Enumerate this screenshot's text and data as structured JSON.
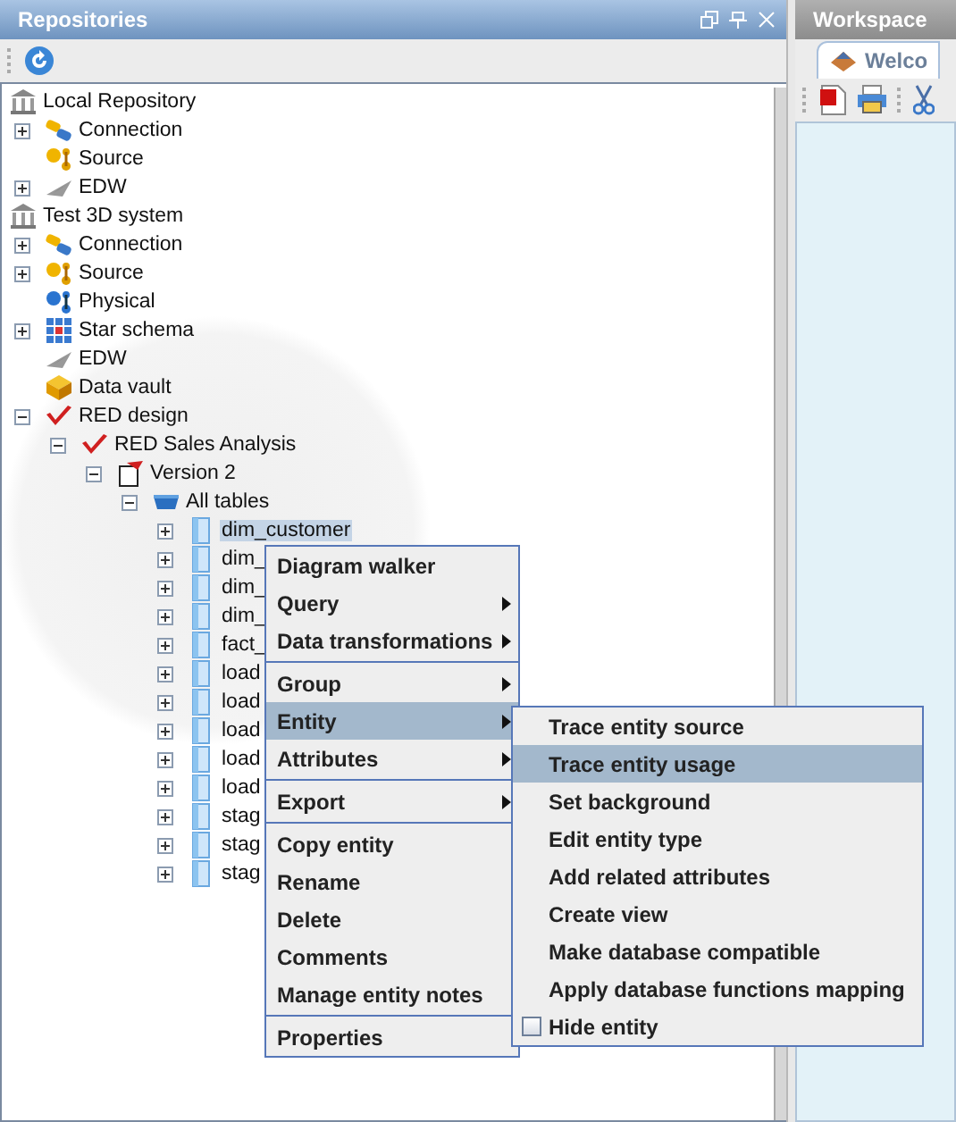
{
  "repositories": {
    "title": "Repositories"
  },
  "tree": [
    {
      "label": "Local Repository",
      "kind": "repository",
      "children": [
        {
          "label": "Connection",
          "kind": "connection",
          "expanded": false
        },
        {
          "label": "Source",
          "kind": "source"
        },
        {
          "label": "EDW",
          "kind": "edw",
          "expanded": false
        }
      ]
    },
    {
      "label": "Test 3D system",
      "kind": "repository",
      "children": [
        {
          "label": "Connection",
          "kind": "connection",
          "expanded": false
        },
        {
          "label": "Source",
          "kind": "source",
          "expanded": false
        },
        {
          "label": "Physical",
          "kind": "physical"
        },
        {
          "label": "Star schema",
          "kind": "star",
          "expanded": false
        },
        {
          "label": "EDW",
          "kind": "edw"
        },
        {
          "label": "Data vault",
          "kind": "vault"
        },
        {
          "label": "RED design",
          "kind": "red",
          "expanded": true,
          "children": [
            {
              "label": "RED Sales Analysis",
              "kind": "red",
              "expanded": true,
              "children": [
                {
                  "label": "Version 2",
                  "kind": "version",
                  "expanded": true,
                  "children": [
                    {
                      "label": "All tables",
                      "kind": "tables",
                      "expanded": true,
                      "children": [
                        {
                          "label": "dim_customer",
                          "kind": "table",
                          "expanded": false,
                          "selected": true
                        },
                        {
                          "label": "dim_",
                          "kind": "table",
                          "expanded": false,
                          "selected": false
                        },
                        {
                          "label": "dim_",
                          "kind": "table",
                          "expanded": false,
                          "selected": false
                        },
                        {
                          "label": "dim_",
                          "kind": "table",
                          "expanded": false,
                          "selected": false
                        },
                        {
                          "label": "fact_",
                          "kind": "table",
                          "expanded": false,
                          "selected": false
                        },
                        {
                          "label": "load",
                          "kind": "table",
                          "expanded": false,
                          "selected": false
                        },
                        {
                          "label": "load",
                          "kind": "table",
                          "expanded": false,
                          "selected": false
                        },
                        {
                          "label": "load",
                          "kind": "table",
                          "expanded": false,
                          "selected": false
                        },
                        {
                          "label": "load",
                          "kind": "table",
                          "expanded": false,
                          "selected": false
                        },
                        {
                          "label": "load",
                          "kind": "table",
                          "expanded": false,
                          "selected": false
                        },
                        {
                          "label": "stag",
                          "kind": "table",
                          "expanded": false,
                          "selected": false
                        },
                        {
                          "label": "stag",
                          "kind": "table",
                          "expanded": false,
                          "selected": false
                        },
                        {
                          "label": "stag",
                          "kind": "table",
                          "expanded": false,
                          "selected": false
                        }
                      ]
                    }
                  ]
                }
              ]
            }
          ]
        }
      ]
    }
  ],
  "context_menu": {
    "groups": [
      [
        {
          "label": "Diagram walker",
          "submenu": false,
          "selected": false
        },
        {
          "label": "Query",
          "submenu": true,
          "selected": false
        },
        {
          "label": "Data transformations",
          "submenu": true,
          "selected": false
        }
      ],
      [
        {
          "label": "Group",
          "submenu": true,
          "selected": false
        },
        {
          "label": "Entity",
          "submenu": true,
          "selected": true
        },
        {
          "label": "Attributes",
          "submenu": true,
          "selected": false
        }
      ],
      [
        {
          "label": "Export",
          "submenu": true,
          "selected": false
        }
      ],
      [
        {
          "label": "Copy entity",
          "submenu": false,
          "selected": false
        },
        {
          "label": "Rename",
          "submenu": false,
          "selected": false
        },
        {
          "label": "Delete",
          "submenu": false,
          "selected": false
        },
        {
          "label": "Comments",
          "submenu": false,
          "selected": false
        },
        {
          "label": "Manage entity notes",
          "submenu": false,
          "selected": false
        }
      ],
      [
        {
          "label": "Properties",
          "submenu": false,
          "selected": false
        }
      ]
    ]
  },
  "entity_submenu": [
    {
      "label": "Trace entity source",
      "kind": "command",
      "selected": false
    },
    {
      "label": "Trace entity usage",
      "kind": "command",
      "selected": true
    },
    {
      "label": "Set background",
      "kind": "command",
      "selected": false
    },
    {
      "label": "Edit entity type",
      "kind": "command",
      "selected": false
    },
    {
      "label": "Add related attributes",
      "kind": "command",
      "selected": false
    },
    {
      "label": "Create view",
      "kind": "command",
      "selected": false
    },
    {
      "label": "Make database compatible",
      "kind": "command",
      "selected": false
    },
    {
      "label": "Apply database functions mapping",
      "kind": "command",
      "selected": false
    },
    {
      "label": "Hide entity",
      "kind": "checkbox",
      "checked": false,
      "selected": false
    }
  ],
  "workspace": {
    "title": "Workspace",
    "tabs": [
      {
        "label": "Welco",
        "selected": true
      }
    ]
  }
}
